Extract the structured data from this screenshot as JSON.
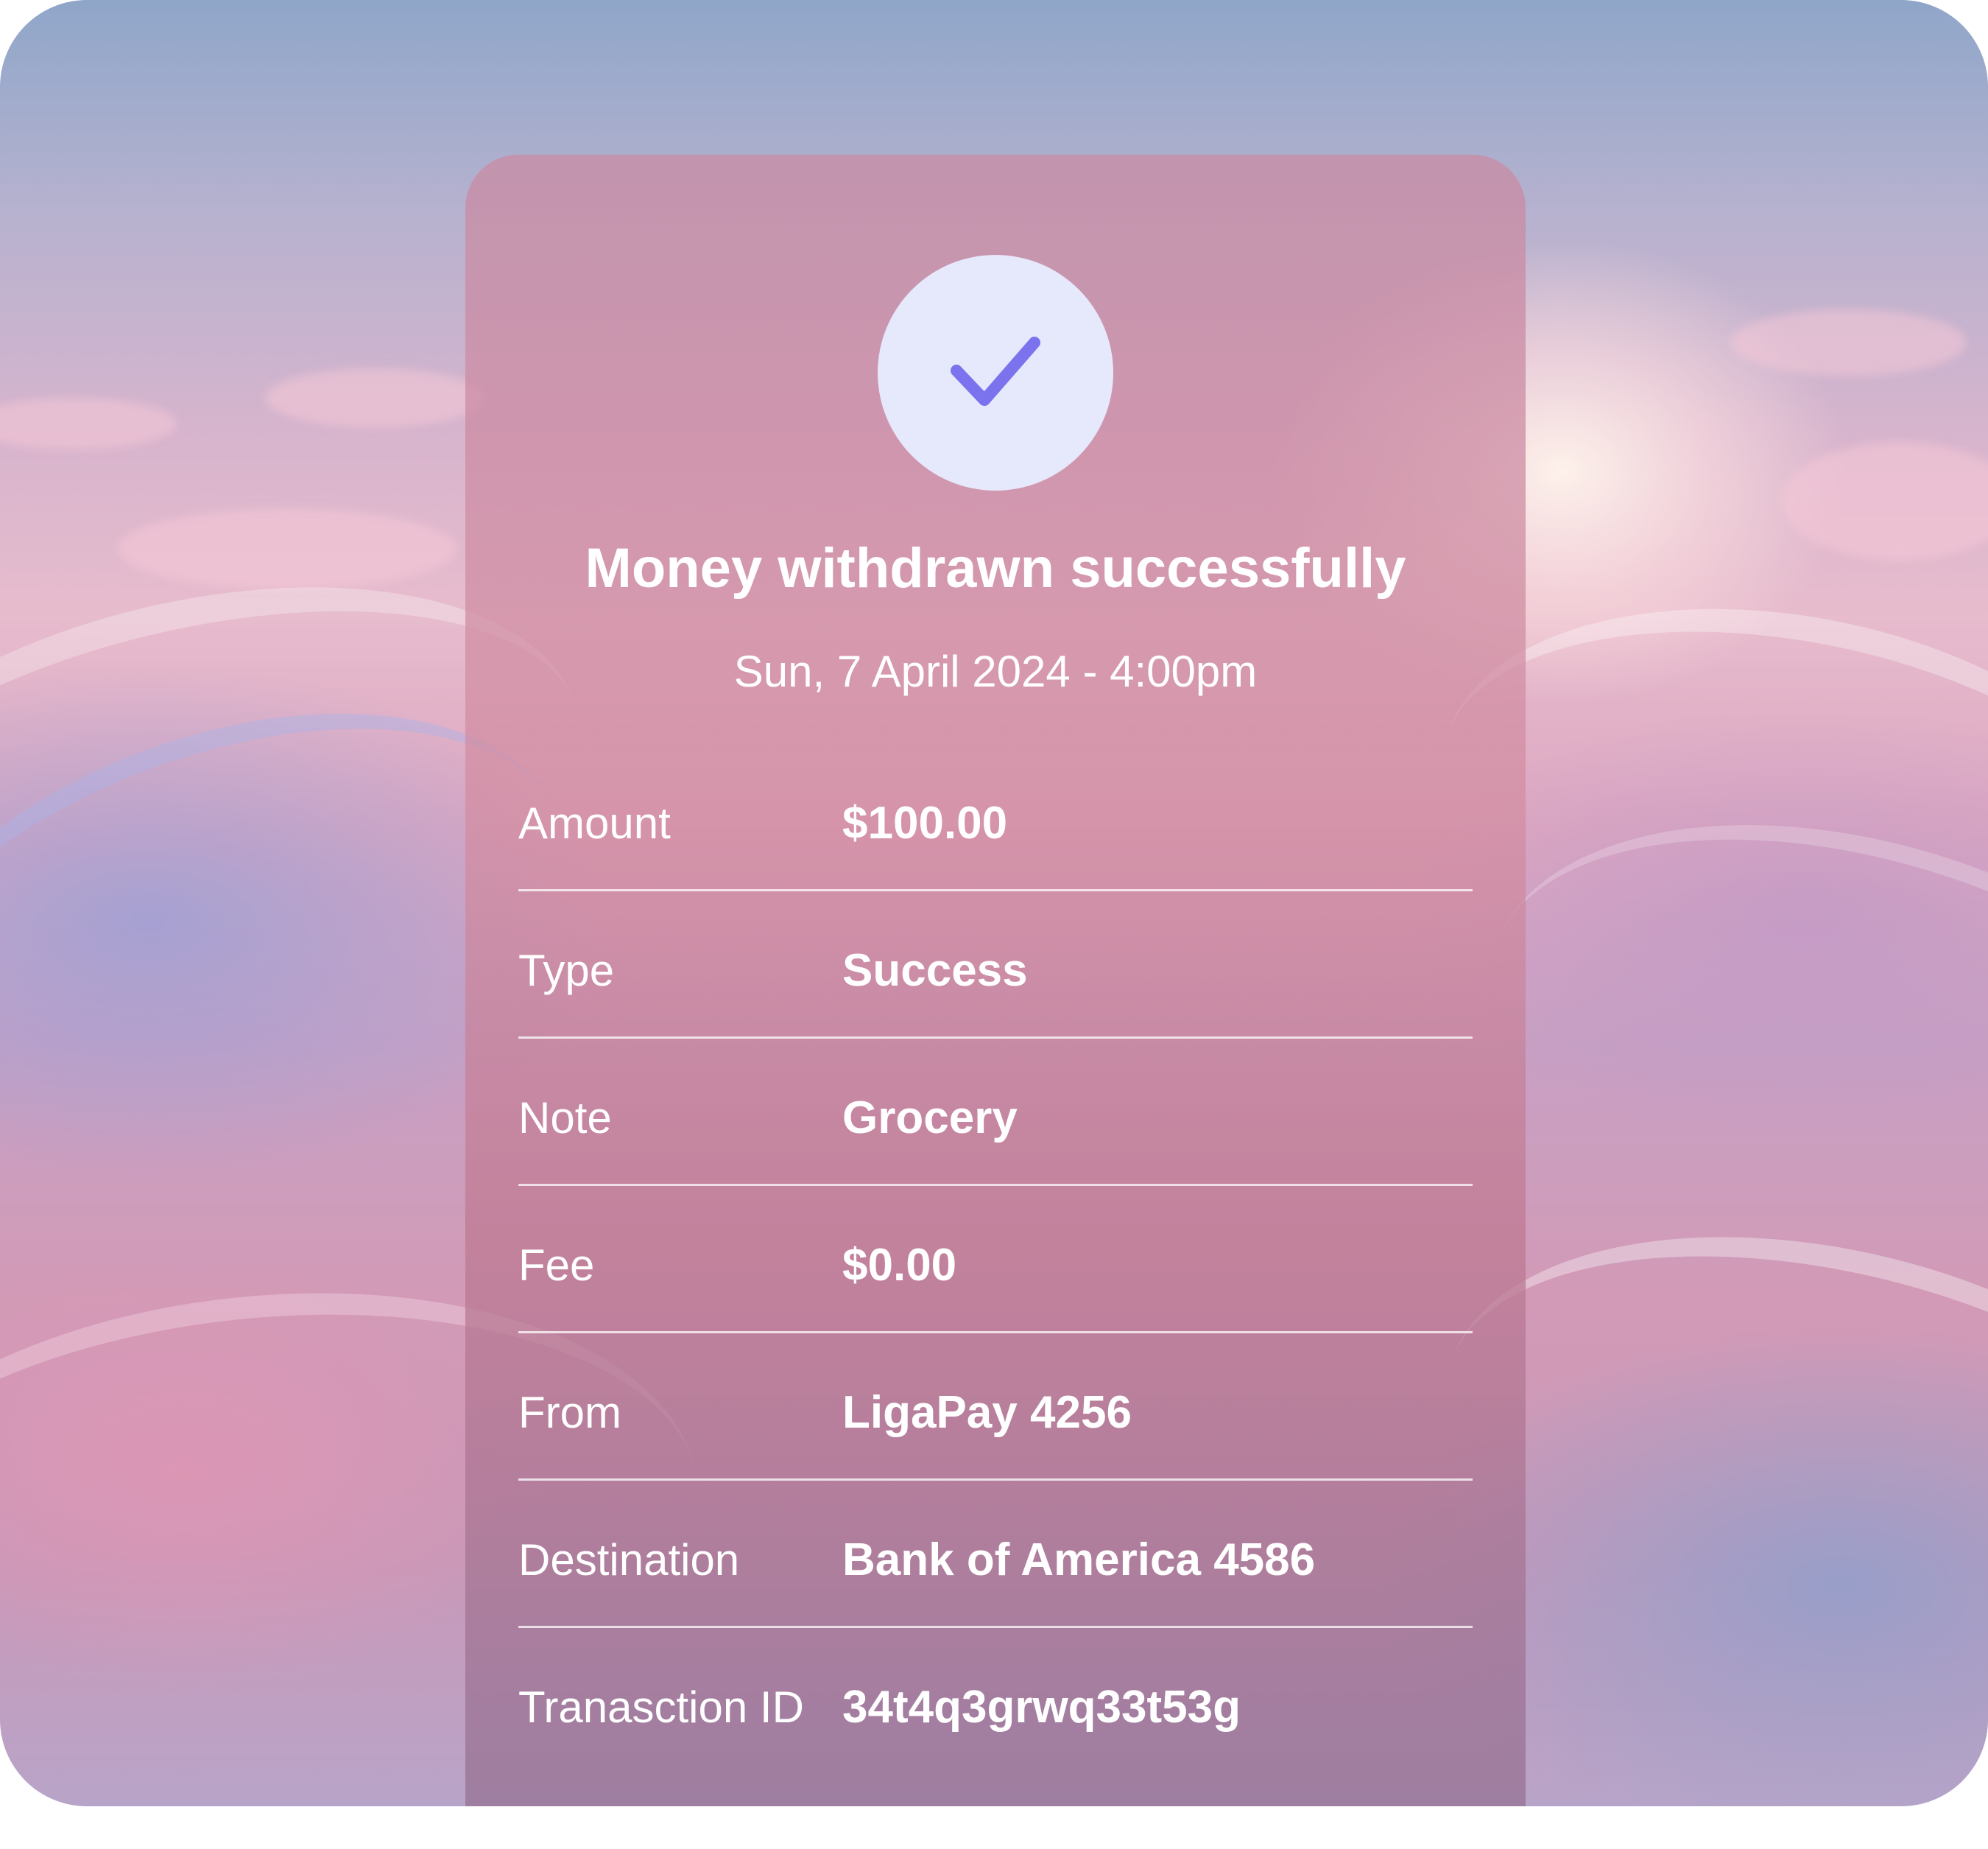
{
  "receipt": {
    "title": "Money withdrawn successfully",
    "datetime": "Sun, 7 April 2024 - 4:00pm",
    "status_icon": "check-icon",
    "rows": [
      {
        "label": "Amount",
        "value": "$100.00"
      },
      {
        "label": "Type",
        "value": "Success"
      },
      {
        "label": "Note",
        "value": "Grocery"
      },
      {
        "label": "Fee",
        "value": "$0.00"
      },
      {
        "label": "From",
        "value": "LigaPay 4256"
      },
      {
        "label": "Destination",
        "value": "Bank of America 4586"
      },
      {
        "label": "Tranasction ID",
        "value": "34t4q3grwq33t53g"
      }
    ]
  },
  "colors": {
    "check_circle_bg": "#e6e8fb",
    "check_mark": "#7b72ee",
    "text": "#ffffff"
  }
}
